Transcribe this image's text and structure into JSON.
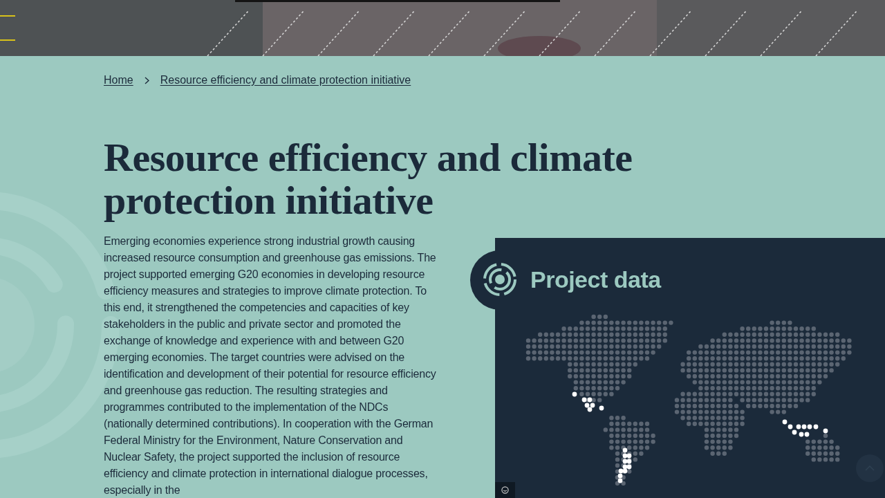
{
  "breadcrumb": [
    {
      "label": "Home"
    },
    {
      "label": "Resource efficiency and climate protection initiative"
    }
  ],
  "title": "Resource efficiency and climate protection initiative",
  "description": "Emerging economies experience strong industrial growth causing increased resource consumption and greenhouse gas emissions. The project supported emerging G20 economies in developing resource efficiency measures and strategies to improve climate protection. To this end, it strengthened the competencies and capacities of key stakeholders in the public and private sector and promoted the exchange of knowledge and experience with and between G20 emerging economies. The target countries were advised on the identification and development of their potential for resource efficiency and greenhouse gas reduction. The resulting strategies and programmes contributed to the implementation of the NDCs (nationally determined contributions). In cooperation with the German Federal Ministry for the Environment, Nature Conservation and Nuclear Safety, the project supported the inclusion of resource efficiency and climate protection in international dialogue processes, especially in the",
  "project_data": {
    "title": "Project data"
  }
}
